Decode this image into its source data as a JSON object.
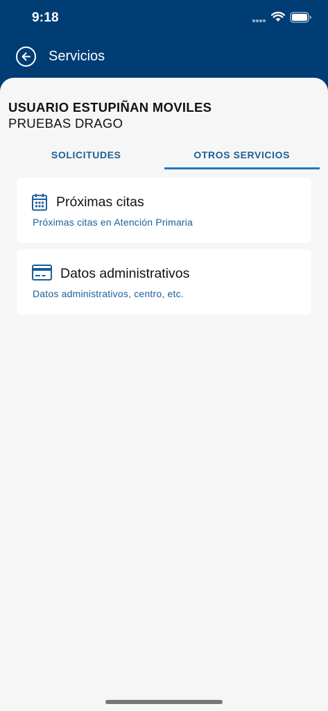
{
  "status_bar": {
    "time": "9:18"
  },
  "header": {
    "title": "Servicios",
    "back_icon": "arrow-left-circle-icon"
  },
  "user": {
    "name": "USUARIO ESTUPIÑAN MOVILES",
    "subname": "PRUEBAS DRAGO"
  },
  "tabs": [
    {
      "label": "SOLICITUDES",
      "active": false
    },
    {
      "label": "OTROS SERVICIOS",
      "active": true
    }
  ],
  "cards": [
    {
      "icon": "calendar-icon",
      "title": "Próximas citas",
      "subtitle": "Próximas citas en Atención Primaria"
    },
    {
      "icon": "id-card-icon",
      "title": "Datos administrativos",
      "subtitle": "Datos administrativos, centro, etc."
    }
  ],
  "colors": {
    "header_bg": "#003d75",
    "accent": "#1e78c8",
    "link_text": "#1b5e9a",
    "page_bg": "#f6f6f6"
  }
}
